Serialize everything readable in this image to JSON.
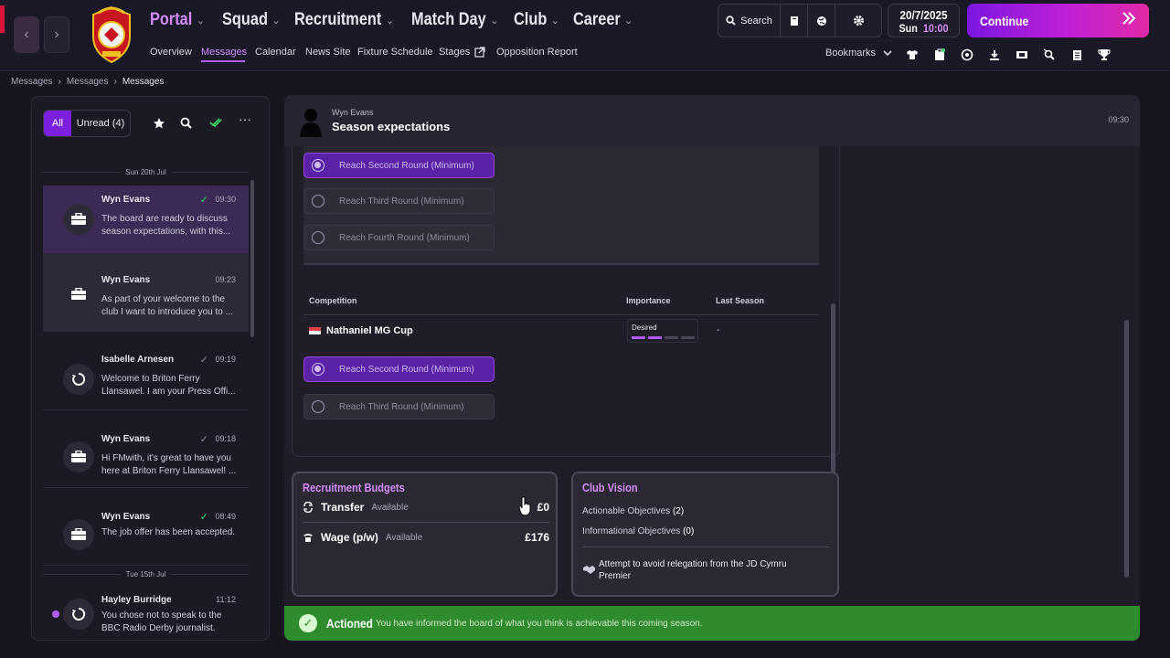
{
  "nav": {
    "back": "‹",
    "forward": "›"
  },
  "menu": {
    "portal": "Portal",
    "squad": "Squad",
    "recruitment": "Recruitment",
    "match_day": "Match Day",
    "club": "Club",
    "career": "Career"
  },
  "submenu": {
    "overview": "Overview",
    "messages": "Messages",
    "calendar": "Calendar",
    "news_site": "News Site",
    "fixture_schedule": "Fixture Schedule",
    "stages": "Stages",
    "opposition_report": "Opposition Report"
  },
  "toolbar": {
    "search": "Search",
    "bookmarks": "Bookmarks",
    "date": "20/7/2025",
    "day": "Sun",
    "time": "10:00",
    "continue": "Continue",
    "accent": "#b35cff"
  },
  "breadcrumb": [
    "Messages",
    "Messages",
    "Messages"
  ],
  "inbox": {
    "filters": {
      "all": "All",
      "unread": "Unread (4)"
    },
    "days": [
      "Sun 20th Jul",
      "Tue 15th Jul"
    ],
    "messages": [
      {
        "sender": "Wyn Evans",
        "time": "09:30",
        "preview": "The board are ready to discuss season expectations, with this...",
        "icon": "briefcase-icon",
        "tick": "green"
      },
      {
        "sender": "Wyn Evans",
        "time": "09:23",
        "preview": "As part of your welcome to the club I want to introduce you to ...",
        "icon": "briefcase-icon",
        "tick": "none"
      },
      {
        "sender": "Isabelle Arnesen",
        "time": "09:19",
        "preview": "Welcome to Briton Ferry Llansawel. I am your Press Offi...",
        "icon": "press-icon",
        "tick": "grey"
      },
      {
        "sender": "Wyn Evans",
        "time": "09:18",
        "preview": "Hi FMwith, it's great to have you here at Briton Ferry Llansawel! ...",
        "icon": "briefcase-icon",
        "tick": "grey"
      },
      {
        "sender": "Wyn Evans",
        "time": "08:49",
        "preview": "The job offer has been accepted.",
        "icon": "briefcase-icon",
        "tick": "green"
      },
      {
        "sender": "Hayley Burridge",
        "time": "11:12",
        "preview": "You chose not to speak to the BBC Radio Derby journalist.",
        "icon": "press-icon",
        "tick": "none"
      }
    ]
  },
  "message": {
    "sender": "Wyn Evans",
    "subject": "Season expectations",
    "time": "09:30",
    "options_a": [
      "Reach Second Round (Minimum)",
      "Reach Third Round (Minimum)",
      "Reach Fourth Round (Minimum)"
    ],
    "table_headers": {
      "competition": "Competition",
      "importance": "Importance",
      "last_season": "Last Season"
    },
    "competition": {
      "name": "Nathaniel MG Cup",
      "importance": "Desired",
      "importance_level": 2,
      "importance_max": 4,
      "last_season": "-"
    },
    "options_b": [
      "Reach Second Round (Minimum)",
      "Reach Third Round (Minimum)"
    ]
  },
  "recruitment_budgets": {
    "title": "Recruitment Budgets",
    "transfer": {
      "label": "Transfer",
      "status": "Available",
      "amount": "£0"
    },
    "wage": {
      "label": "Wage (p/w)",
      "status": "Available",
      "amount": "£176"
    }
  },
  "club_vision": {
    "title": "Club Vision",
    "actionable": "Actionable Objectives",
    "actionable_count": "(2)",
    "informational": "Informational Objectives",
    "informational_count": "(0)",
    "objective": "Attempt to avoid relegation from the JD Cymru Premier"
  },
  "action_bar": {
    "title": "Actioned",
    "text": "You have informed the board of what you think is achievable this coming season.",
    "color": "#2e8b2e"
  }
}
